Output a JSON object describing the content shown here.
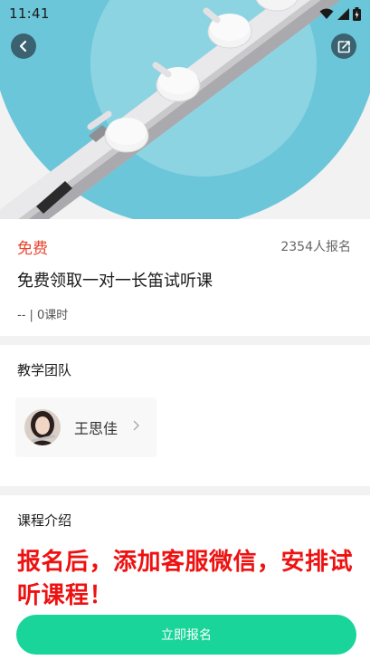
{
  "status_bar": {
    "time": "11:41"
  },
  "hero": {
    "image_subject": "flute"
  },
  "course": {
    "price_label": "免费",
    "enroll_count": "2354人报名",
    "title": "免费领取一对一长笛试听课",
    "meta": "-- | 0课时"
  },
  "team": {
    "heading": "教学团队",
    "teachers": [
      {
        "name": "王思佳"
      }
    ]
  },
  "intro": {
    "heading": "课程介绍",
    "text": "报名后，添加客服微信，安排试听课程！"
  },
  "footer": {
    "signup_label": "立即报名"
  },
  "colors": {
    "accent": "#19d59a",
    "price": "#e8432d",
    "promo_text": "#ee1111",
    "hero_bg": "#6cc6d9"
  },
  "icons": [
    "back-arrow-icon",
    "share-icon",
    "wifi-icon",
    "signal-icon",
    "battery-icon",
    "chevron-right-icon"
  ]
}
